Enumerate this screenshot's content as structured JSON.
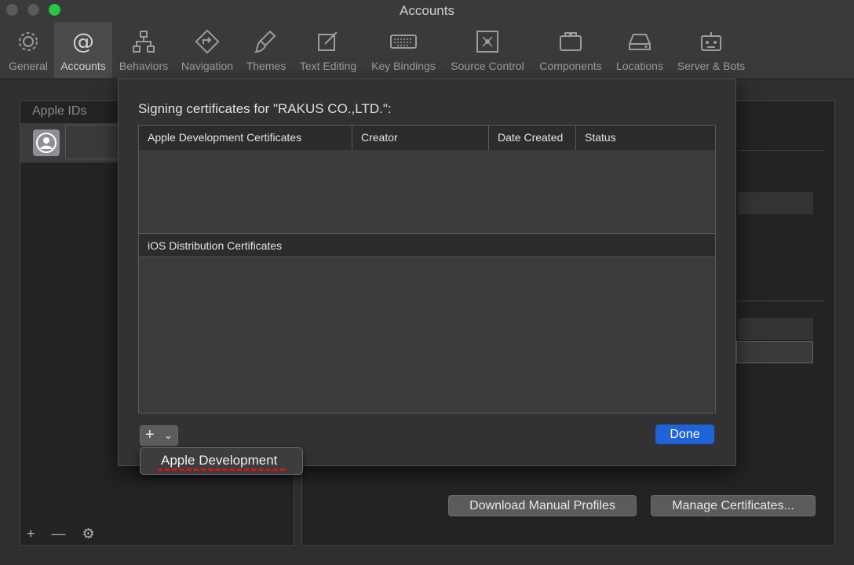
{
  "window": {
    "title": "Accounts"
  },
  "toolbar": {
    "tabs": [
      {
        "label": "General",
        "icon": "gear-icon"
      },
      {
        "label": "Accounts",
        "icon": "at-sign-icon",
        "active": true
      },
      {
        "label": "Behaviors",
        "icon": "hierarchy-icon"
      },
      {
        "label": "Navigation",
        "icon": "navigation-arrow-icon"
      },
      {
        "label": "Themes",
        "icon": "paintbrush-icon"
      },
      {
        "label": "Text Editing",
        "icon": "edit-icon"
      },
      {
        "label": "Key Bindings",
        "icon": "keyboard-icon"
      },
      {
        "label": "Source Control",
        "icon": "source-control-icon"
      },
      {
        "label": "Components",
        "icon": "components-icon"
      },
      {
        "label": "Locations",
        "icon": "drive-icon"
      },
      {
        "label": "Server & Bots",
        "icon": "robot-icon"
      }
    ]
  },
  "left_pane": {
    "header": "Apple IDs",
    "footer": {
      "add": "+",
      "remove": "—",
      "settings": "⚙"
    }
  },
  "right_pane": {
    "download_label": "Download Manual Profiles",
    "manage_label": "Manage Certificates..."
  },
  "sheet": {
    "title": "Signing certificates for \"RAKUS CO.,LTD.\":",
    "columns": [
      "Apple Development Certificates",
      "Creator",
      "Date Created",
      "Status"
    ],
    "section2": "iOS Distribution Certificates",
    "add_button": "+",
    "add_chevron": "⌄",
    "done_label": "Done"
  },
  "menu": {
    "items": [
      "Apple Development"
    ]
  },
  "colors": {
    "accent": "#1e64d8",
    "annotation": "#e0101a",
    "zoom": "#28c840"
  }
}
